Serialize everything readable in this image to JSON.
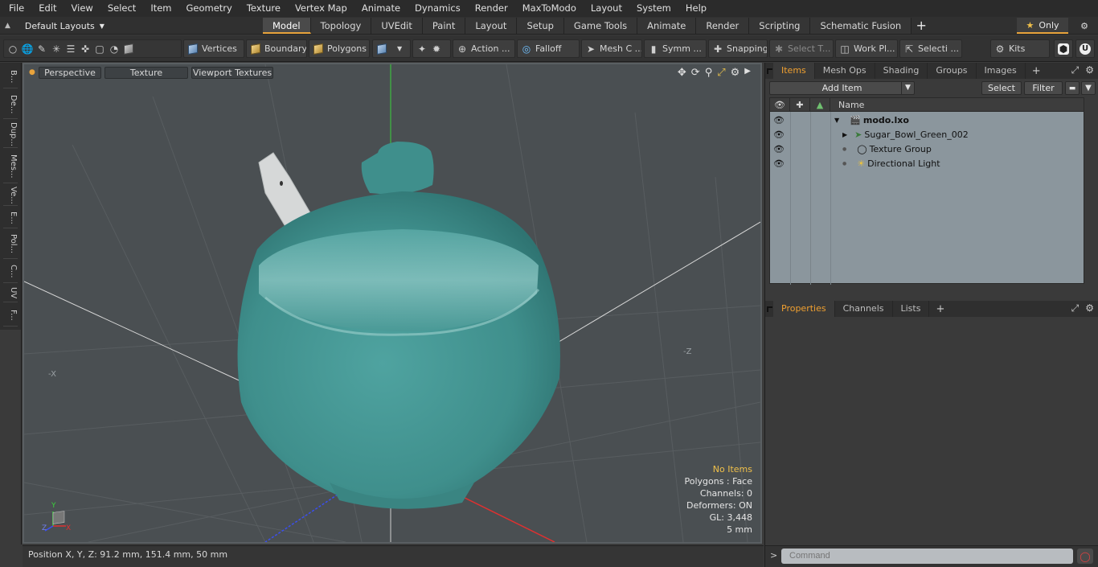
{
  "menu": [
    "File",
    "Edit",
    "View",
    "Select",
    "Item",
    "Geometry",
    "Texture",
    "Vertex Map",
    "Animate",
    "Dynamics",
    "Render",
    "MaxToModo",
    "Layout",
    "System",
    "Help"
  ],
  "layouts_label": "Default Layouts",
  "layout_tabs": [
    "Model",
    "Topology",
    "UVEdit",
    "Paint",
    "Layout",
    "Setup",
    "Game Tools",
    "Animate",
    "Render",
    "Scripting",
    "Schematic Fusion"
  ],
  "active_layout_tab": "Model",
  "only_label": "Only",
  "toolbar": {
    "vertices": "Vertices",
    "boundary": "Boundary",
    "polygons": "Polygons",
    "action": "Action ...",
    "falloff": "Falloff",
    "mesh": "Mesh C ...",
    "symmetry": "Symm ...",
    "snapping": "Snapping",
    "select_t": "Select T...",
    "work_plane": "Work Pl...",
    "selection": "Selecti ...",
    "kits": "Kits"
  },
  "left_tabs": [
    "B...",
    "De...",
    "Dup...",
    "Mes...",
    "Ve...",
    "E...",
    "Pol...",
    "C...",
    "UV",
    "F..."
  ],
  "viewport": {
    "view_mode": "Perspective",
    "shading": "Texture",
    "viewport_textures": "Viewport Textures",
    "info": {
      "no_items": "No Items",
      "polygons": "Polygons : Face",
      "channels": "Channels: 0",
      "deformers": "Deformers: ON",
      "gl": "GL: 3,448",
      "unit": "5 mm"
    },
    "axis_labels": {
      "z_neg": "-Z",
      "x_neg": "-X",
      "gizmo_y": "Y",
      "gizmo_z": "Z",
      "gizmo_x": "X"
    },
    "colors": {
      "body": "#3f8f8c",
      "grid": "#5a5f62"
    }
  },
  "status": {
    "position": "Position X, Y, Z:   91.2 mm, 151.4 mm, 50 mm"
  },
  "items_panel": {
    "tabs": [
      "Items",
      "Mesh Ops",
      "Shading",
      "Groups",
      "Images"
    ],
    "active_tab": "Items",
    "add_item": "Add Item",
    "select": "Select",
    "filter": "Filter",
    "column_name": "Name",
    "tree": [
      {
        "label": "modo.lxo",
        "depth": 0
      },
      {
        "label": "Sugar_Bowl_Green_002",
        "depth": 1
      },
      {
        "label": "Texture Group",
        "depth": 1
      },
      {
        "label": "Directional Light",
        "depth": 1
      }
    ]
  },
  "props_panel": {
    "tabs": [
      "Properties",
      "Channels",
      "Lists"
    ],
    "active_tab": "Properties"
  },
  "command": {
    "placeholder": "Command"
  },
  "accent": "#e8a33c"
}
